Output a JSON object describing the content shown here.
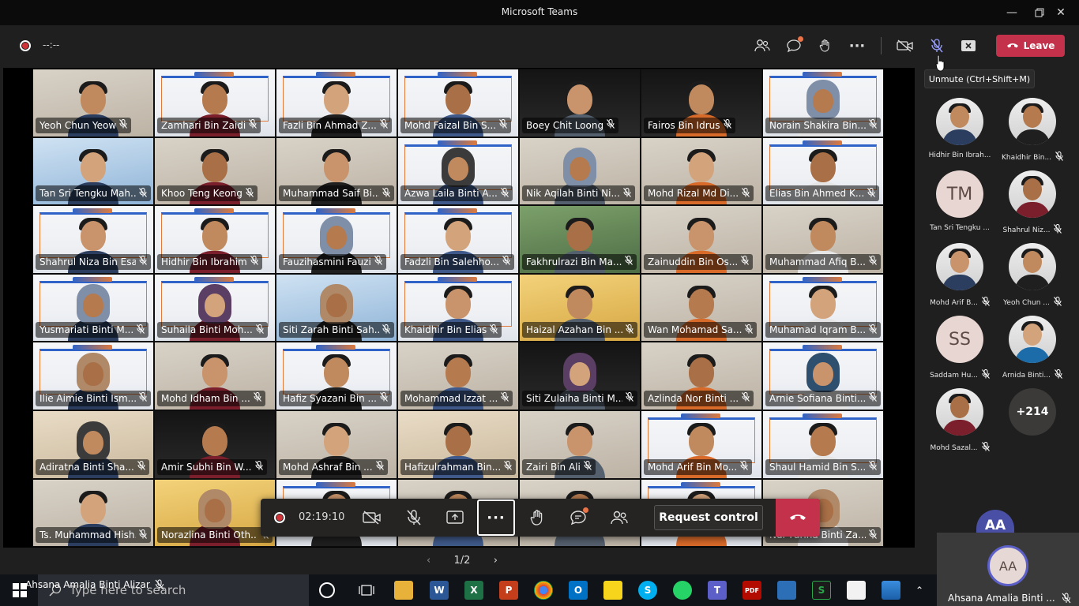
{
  "window": {
    "title": "Microsoft Teams"
  },
  "meeting_toolbar": {
    "recording_time": "--:--",
    "leave_label": "Leave",
    "tooltip": "Unmute (Ctrl+Shift+M)"
  },
  "grid": {
    "tiles": [
      {
        "name": "Yeoh Chun Yeow",
        "style": "home"
      },
      {
        "name": "Zamhari Bin Zaidi",
        "style": "banner"
      },
      {
        "name": "Fazli Bin Ahmad Z...",
        "style": "banner"
      },
      {
        "name": "Mohd Faizal Bin S...",
        "style": "banner"
      },
      {
        "name": "Boey Chit Loong",
        "style": "dark"
      },
      {
        "name": "Fairos Bin Idrus",
        "style": "dark"
      },
      {
        "name": "Norain Shakira Bin...",
        "style": "banner",
        "hijab": true
      },
      {
        "name": "Tan Sri Tengku Mah...",
        "style": "blue"
      },
      {
        "name": "Khoo Teng Keong",
        "style": "home"
      },
      {
        "name": "Muhammad Saif Bi...",
        "style": "home"
      },
      {
        "name": "Azwa Laila Binti A...",
        "style": "banner",
        "hijab": true
      },
      {
        "name": "Nik Aqilah Binti Ni...",
        "style": "home",
        "hijab": true
      },
      {
        "name": "Mohd Rizal Md Di...",
        "style": "home"
      },
      {
        "name": "Elias Bin Ahmed K...",
        "style": "banner"
      },
      {
        "name": "Shahrul Niza Bin Esa",
        "style": "banner"
      },
      {
        "name": "Hidhir Bin Ibrahim",
        "style": "banner"
      },
      {
        "name": "Fauzihasmini Fauzi",
        "style": "banner",
        "hijab": true
      },
      {
        "name": "Fadzli Bin Salehho...",
        "style": "banner"
      },
      {
        "name": "Fakhrulrazi Bin Ma...",
        "style": "greenbg"
      },
      {
        "name": "Zainuddin Bin Os...",
        "style": "home"
      },
      {
        "name": "Muhammad Afiq B...",
        "style": "home"
      },
      {
        "name": "Yusmariati Binti M...",
        "style": "banner",
        "hijab": true
      },
      {
        "name": "Suhaila Binti Moh...",
        "style": "banner",
        "hijab": true
      },
      {
        "name": "Siti Zarah Binti Sah...",
        "style": "blue",
        "hijab": true
      },
      {
        "name": "Khaidhir Bin Elias",
        "style": "banner"
      },
      {
        "name": "Haizal Azahan Bin ...",
        "style": "yellow"
      },
      {
        "name": "Wan Mohamad Sa...",
        "style": "home"
      },
      {
        "name": "Muhamad Iqram B...",
        "style": "banner"
      },
      {
        "name": "Ilie Aimie Binti Ism...",
        "style": "banner",
        "hijab": true
      },
      {
        "name": "Mohd Idham Bin ...",
        "style": "home"
      },
      {
        "name": "Hafiz Syazani Bin ...",
        "style": "banner"
      },
      {
        "name": "Mohammad Izzat ...",
        "style": "home"
      },
      {
        "name": "Siti Zulaiha Binti M...",
        "style": "dark",
        "hijab": true
      },
      {
        "name": "Azlinda Nor Binti ...",
        "style": "home"
      },
      {
        "name": "Arnie Sofiana Binti...",
        "style": "banner",
        "hijab": true
      },
      {
        "name": "Adiratna Binti Sha...",
        "style": "warm",
        "hijab": true
      },
      {
        "name": "Amir Subhi Bin W...",
        "style": "dark"
      },
      {
        "name": "Mohd Ashraf Bin ...",
        "style": "home"
      },
      {
        "name": "Hafizulrahman Bin...",
        "style": "warm"
      },
      {
        "name": "Zairi Bin Ali",
        "style": "home"
      },
      {
        "name": "Mohd Arif Bin Mo...",
        "style": "banner"
      },
      {
        "name": "Shaul Hamid Bin S...",
        "style": "banner"
      },
      {
        "name": "Ts. Muhammad Hish...",
        "style": "home"
      },
      {
        "name": "Norazlina Binti Oth...",
        "style": "yellow",
        "hijab": true
      },
      {
        "name": "",
        "style": "banner"
      },
      {
        "name": "",
        "style": "home"
      },
      {
        "name": "",
        "style": "home"
      },
      {
        "name": "",
        "style": "banner"
      },
      {
        "name": "Nur Farina Binti Za...",
        "style": "home",
        "hijab": true
      }
    ]
  },
  "call_controls": {
    "duration": "02:19:10",
    "request_control_label": "Request control"
  },
  "pager": {
    "label": "1/2"
  },
  "attendees": [
    {
      "name": "Hidhir Bin Ibrah...",
      "type": "photo",
      "muted": false
    },
    {
      "name": "Khaidhir Bin...",
      "type": "photo",
      "muted": true
    },
    {
      "name": "Tan Sri Tengku ...",
      "type": "initials",
      "initials": "TM",
      "muted": false
    },
    {
      "name": "Shahrul Niz...",
      "type": "photo",
      "muted": true
    },
    {
      "name": "Mohd Arif B...",
      "type": "photo",
      "muted": true
    },
    {
      "name": "Yeoh Chun ...",
      "type": "photo",
      "muted": true
    },
    {
      "name": "Saddam Hu...",
      "type": "initials",
      "initials": "SS",
      "muted": true
    },
    {
      "name": "Arnida Binti...",
      "type": "photo",
      "muted": true
    },
    {
      "name": "Mohd Sazal...",
      "type": "photo",
      "muted": true
    },
    {
      "name": "",
      "type": "more",
      "initials": "+214",
      "muted": false
    }
  ],
  "self": {
    "initials": "AA",
    "name": "Ahsana Amalia Binti ...",
    "overlay_name": "Ahsana Amalia Binti Alizar"
  },
  "taskbar": {
    "search_placeholder": "Type here to search"
  },
  "colors": {
    "leave_red": "#c4314b",
    "teams_purple": "#5b5fc7",
    "recording_red": "#d13438"
  }
}
